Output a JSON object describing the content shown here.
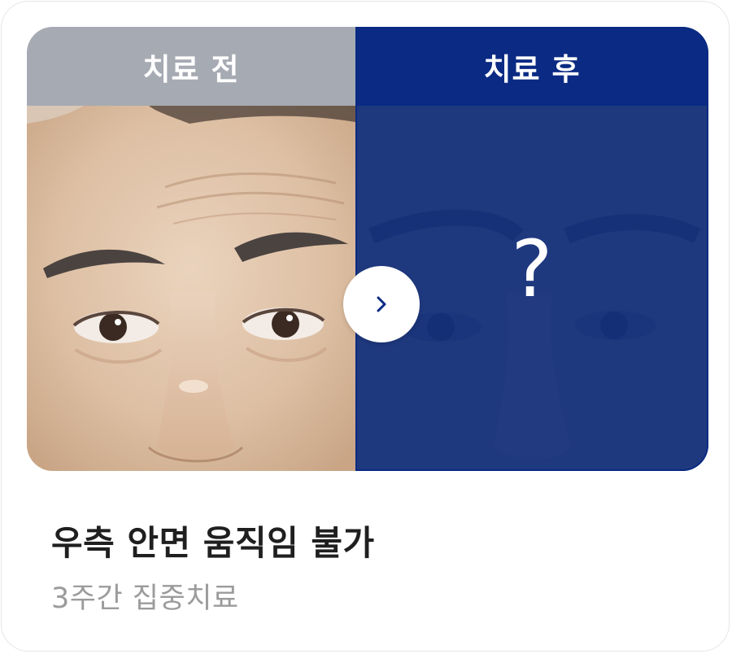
{
  "comparison": {
    "before_label": "치료 전",
    "after_label": "치료 후",
    "after_placeholder": "?",
    "next_icon": "chevron-right-icon"
  },
  "caption": {
    "title": "우측 안면 움직임 불가",
    "subtitle": "3주간 집중치료"
  },
  "colors": {
    "before_header": "#a6aab2",
    "after_header": "#0a2a83",
    "after_overlay": "#122d78",
    "title_text": "#1f1f1f",
    "subtitle_text": "#9b9b9b"
  }
}
